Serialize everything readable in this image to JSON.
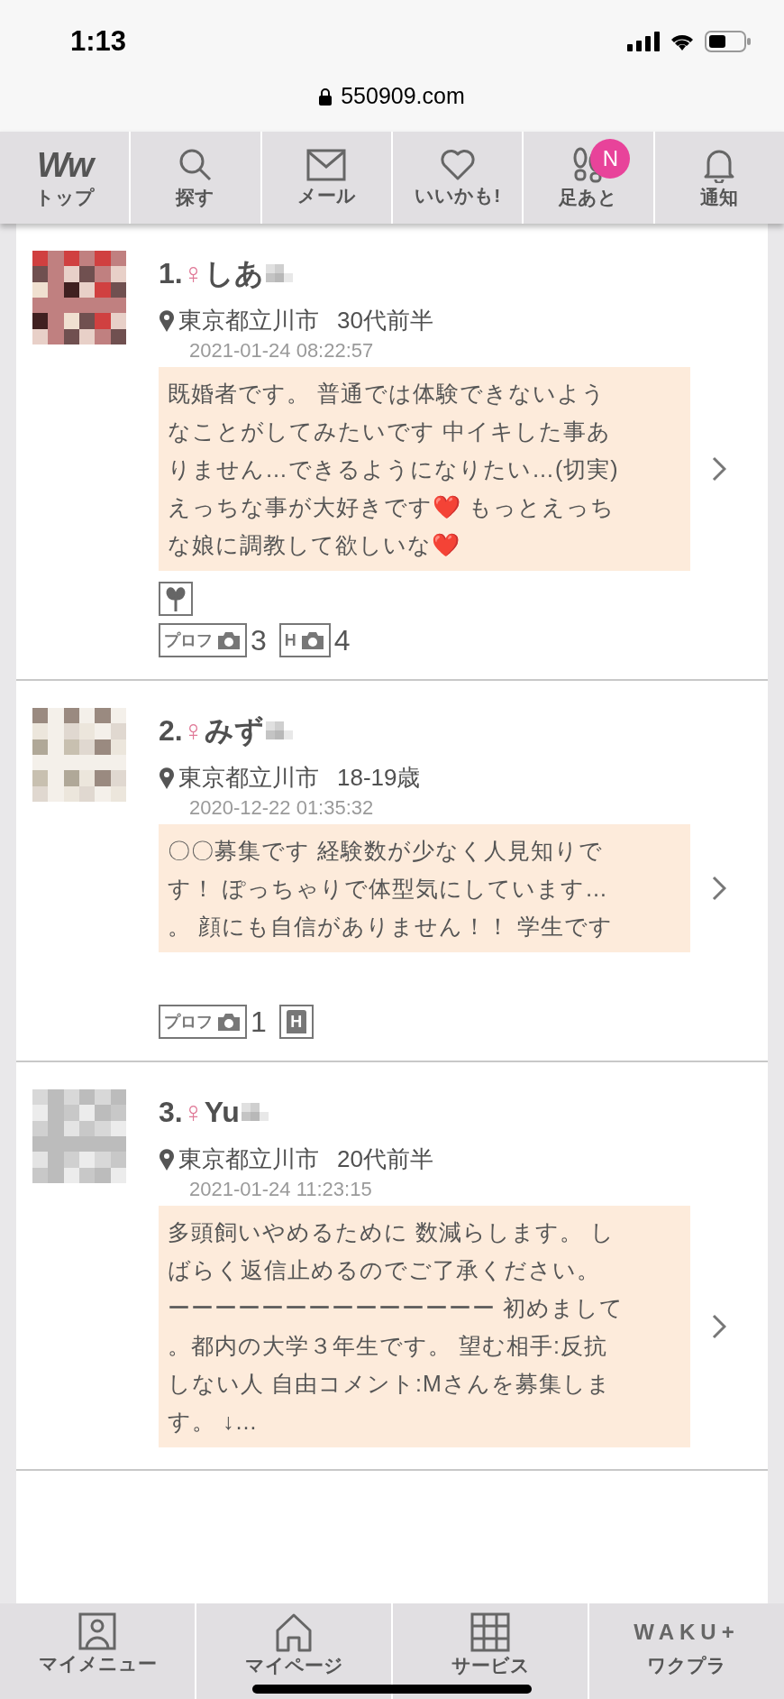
{
  "status_bar": {
    "time": "1:13"
  },
  "browser": {
    "url": "550909.com"
  },
  "nav": [
    {
      "kind": "logo",
      "logo": "Ww",
      "label": "トップ"
    },
    {
      "kind": "search",
      "label": "探す"
    },
    {
      "kind": "mail",
      "label": "メール"
    },
    {
      "kind": "heart",
      "label": "いいかも!"
    },
    {
      "kind": "footprints",
      "label": "足あと",
      "badge": "N"
    },
    {
      "kind": "bell",
      "label": "通知"
    }
  ],
  "profiles": [
    {
      "number": "1.",
      "gender": "♀",
      "name": "しあ",
      "location": "東京都立川市",
      "age": "30代前半",
      "date": "2021-01-24 08:22:57",
      "message_lines": [
        "既婚者です。 普通では体験できないよう",
        "なことがしてみたいです 中イキした事あ",
        "りません…できるようになりたい…(切実)",
        "えっちな事が大好きです❤️ もっとえっち",
        "な娘に調教して欲しいな❤️"
      ],
      "beginner_mark": true,
      "badges": [
        {
          "label": "プロフ",
          "count": "3"
        },
        {
          "label": "H",
          "count": "4"
        }
      ]
    },
    {
      "number": "2.",
      "gender": "♀",
      "name": "みず",
      "location": "東京都立川市",
      "age": "18-19歳",
      "date": "2020-12-22 01:35:32",
      "message_lines": [
        "〇〇募集です 経験数が少なく人見知りで",
        "す！ ぽっちゃりで体型気にしています…",
        "。 顔にも自信がありません！！ 学生です"
      ],
      "beginner_mark": false,
      "badges": [
        {
          "label": "プロフ",
          "count": "1"
        },
        {
          "kind": "letter",
          "label": "H"
        }
      ]
    },
    {
      "number": "3.",
      "gender": "♀",
      "name": "Yu",
      "location": "東京都立川市",
      "age": "20代前半",
      "date": "2021-01-24 11:23:15",
      "message_lines": [
        "多頭飼いやめるために 数減らします。 し",
        "ばらく返信止めるのでご了承ください。",
        "ーーーーーーーーーーーーーー 初めまして",
        "。都内の大学３年生です。 望む相手:反抗",
        "しない人 自由コメント:Mさんを募集しま",
        "す。 ↓…"
      ],
      "beginner_mark": false
    }
  ],
  "tab_bar": [
    {
      "kind": "person",
      "label": "マイメニュー"
    },
    {
      "kind": "home",
      "label": "マイページ"
    },
    {
      "kind": "grid",
      "label": "サービス"
    },
    {
      "kind": "logo",
      "logo": "WAKU+",
      "label": "ワクプラ"
    }
  ]
}
